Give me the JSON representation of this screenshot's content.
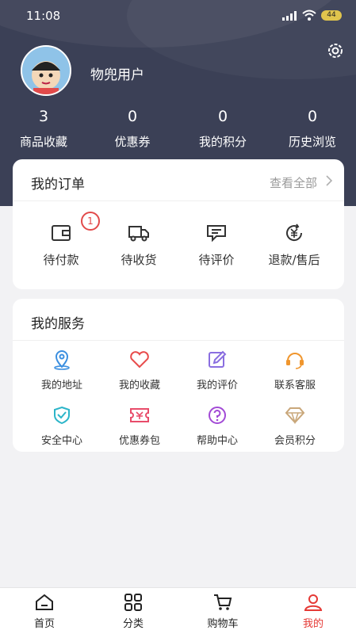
{
  "status_bar": {
    "time": "11:08",
    "battery": "44"
  },
  "profile": {
    "username": "物兜用户"
  },
  "stats": [
    {
      "value": "3",
      "label": "商品收藏"
    },
    {
      "value": "0",
      "label": "优惠券"
    },
    {
      "value": "0",
      "label": "我的积分"
    },
    {
      "value": "0",
      "label": "历史浏览"
    }
  ],
  "orders": {
    "title": "我的订单",
    "view_all": "查看全部",
    "items": [
      {
        "label": "待付款",
        "icon": "wallet-icon",
        "badge": "1"
      },
      {
        "label": "待收货",
        "icon": "truck-icon"
      },
      {
        "label": "待评价",
        "icon": "comment-icon"
      },
      {
        "label": "退款/售后",
        "icon": "refund-icon"
      }
    ]
  },
  "services": {
    "title": "我的服务",
    "items": [
      {
        "label": "我的地址",
        "icon": "location-icon",
        "color": "#3b8fe0"
      },
      {
        "label": "我的收藏",
        "icon": "heart-icon",
        "color": "#e84c4c"
      },
      {
        "label": "我的评价",
        "icon": "edit-icon",
        "color": "#8a6ee0"
      },
      {
        "label": "联系客服",
        "icon": "headset-icon",
        "color": "#f0962e"
      },
      {
        "label": "安全中心",
        "icon": "shield-icon",
        "color": "#2cb5c9"
      },
      {
        "label": "优惠券包",
        "icon": "ticket-icon",
        "color": "#e84c6a"
      },
      {
        "label": "帮助中心",
        "icon": "help-icon",
        "color": "#a24ad6"
      },
      {
        "label": "会员积分",
        "icon": "diamond-icon",
        "color": "#c9a77a"
      }
    ]
  },
  "tabbar": [
    {
      "label": "首页",
      "icon": "home-icon"
    },
    {
      "label": "分类",
      "icon": "category-icon"
    },
    {
      "label": "购物车",
      "icon": "cart-icon"
    },
    {
      "label": "我的",
      "icon": "user-icon",
      "active": true
    }
  ],
  "colors": {
    "header_bg": "#3b4056",
    "accent": "#e53935"
  }
}
